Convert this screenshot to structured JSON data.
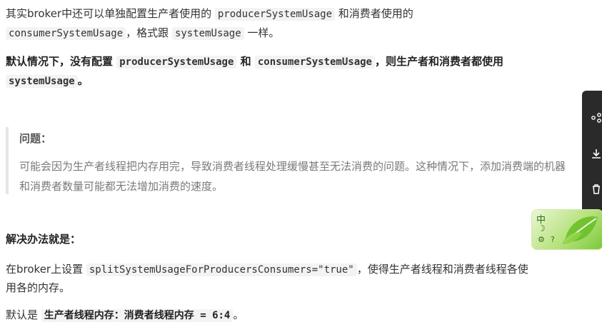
{
  "para1": {
    "t1": "其实broker中还可以单独配置生产者使用的 ",
    "c1": "producerSystemUsage",
    "t2": " 和消费者使用的",
    "c2": "consumerSystemUsage",
    "t3": "，格式跟 ",
    "c3": "systemUsage",
    "t4": " 一样。"
  },
  "para2": {
    "t1": "默认情况下，没有配置 ",
    "c1": "producerSystemUsage",
    "t2": " 和 ",
    "c2": "consumerSystemUsage",
    "t3": "，则生产者和消费者都使用",
    "c3": "systemUsage",
    "t4": "。"
  },
  "note": {
    "title": "问题：",
    "body": "可能会因为生产者线程把内存用完，导致消费者线程处理缓慢甚至无法消费的问题。这种情况下，添加消费端的机器和消费者数量可能都无法增加消费的速度。"
  },
  "solution_heading": "解决办法就是：",
  "para3": {
    "t1": "在broker上设置 ",
    "c1": "splitSystemUsageForProducersConsumers=\"true\"",
    "t2": "，使得生产者线程和消费者线程各使",
    "t3": "用各的内存。"
  },
  "para4": {
    "t1": "默认是 ",
    "c1": "生产者线程内存：消费者线程内存 = 6:4",
    "t2": "。"
  },
  "ime_toolbar": {
    "mode_label": "中",
    "help_label": "?"
  },
  "side_toolbar": {
    "icons": [
      "share-icon",
      "download-icon",
      "delete-icon"
    ]
  }
}
